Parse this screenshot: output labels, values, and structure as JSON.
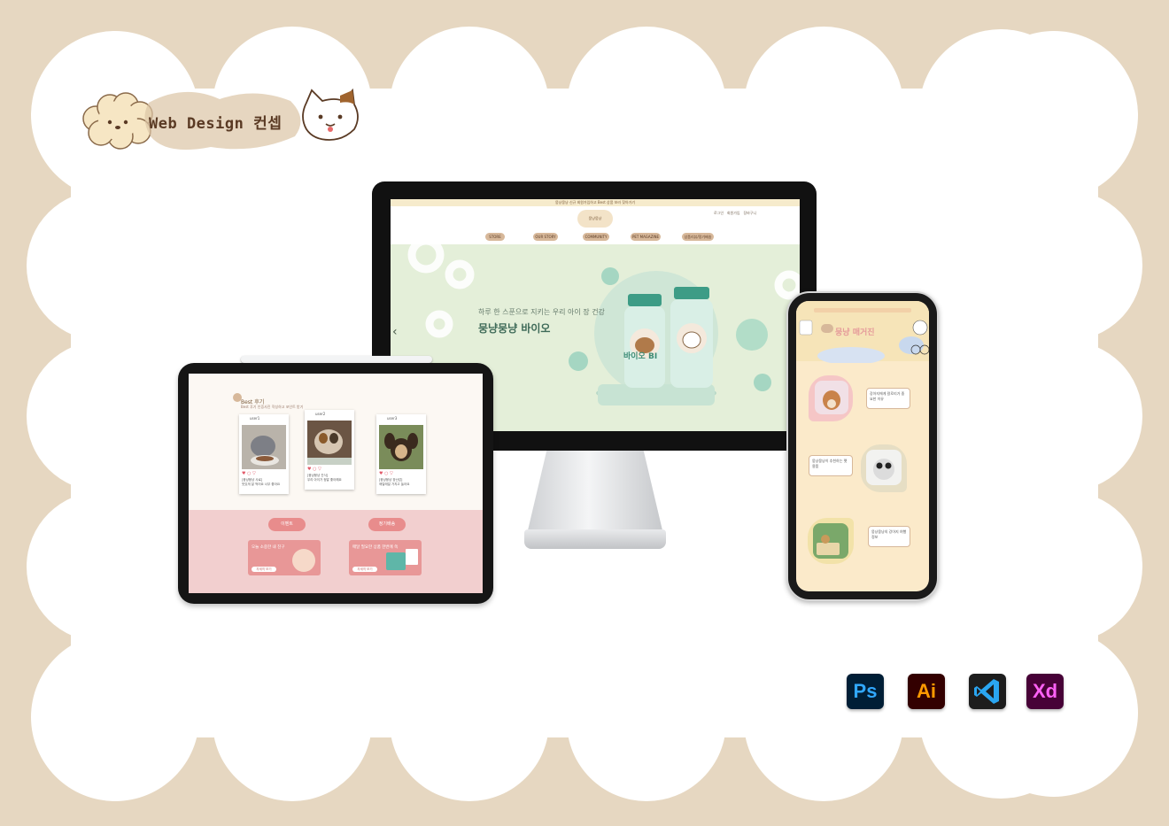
{
  "header": {
    "title": "Web Design 컨셉"
  },
  "monitor": {
    "topbar_text": "뭉냥뭉냥 신규 회원가입하고 Best 상품 보러 찾아가기",
    "logo_text": "뭉냥뭉냥",
    "util_links": [
      "로그인",
      "회원가입",
      "장바구니"
    ],
    "nav": [
      "STORE",
      "OUR STORY",
      "COMMUNITY",
      "PET MAGAZINE",
      "상품리뷰/정기배송"
    ],
    "hero_subtitle": "하루 한 스푼으로 지키는 우리 아이 장 건강",
    "hero_title": "뭉냥뭉냥 바이오",
    "bottle_label": "바이오 BI",
    "prev_arrow": "‹"
  },
  "tablet": {
    "section_title": "Best 후기",
    "section_sub": "Best 후기 인증사진 작성하고 포인트 받기",
    "posts": [
      {
        "user": "user1",
        "title": "[뭉냥뭉냥 사료]",
        "text": "맛있게 잘 먹어요 너무 좋아요"
      },
      {
        "user": "user2",
        "title": "[뭉냥뭉냥 간식]",
        "text": "우리 아이가 정말 좋아해요"
      },
      {
        "user": "user3",
        "title": "[뭉냥뭉냥 장난감]",
        "text": "매일매일 가지고 놀아요"
      }
    ],
    "promo_tags": [
      "이벤트",
      "정기배송"
    ],
    "promo_texts": [
      "오늘 소중한 내 친구",
      "매달 필요한 상품 한번에 쏙"
    ],
    "promo_buttons": [
      "자세히 보기",
      "자세히 보기"
    ]
  },
  "phone": {
    "hero_title": "뭉냥 매거진",
    "cards": [
      {
        "text": "강아지에게 칼로리가 중요한 이유"
      },
      {
        "text": "뭉냥뭉냥이 추천하는 펫 용품"
      },
      {
        "text": "뭉냥뭉냥의 강아지 여행 정보"
      }
    ]
  },
  "tools": [
    {
      "label": "Ps",
      "name": "photoshop-icon",
      "bg": "#001e36",
      "fg": "#31a8ff"
    },
    {
      "label": "Ai",
      "name": "illustrator-icon",
      "bg": "#330000",
      "fg": "#ff9a00"
    },
    {
      "label": "",
      "name": "vscode-icon",
      "bg": "#1d1d1d",
      "fg": "#2aa6f2"
    },
    {
      "label": "Xd",
      "name": "xd-icon",
      "bg": "#470137",
      "fg": "#ff61f6"
    }
  ]
}
